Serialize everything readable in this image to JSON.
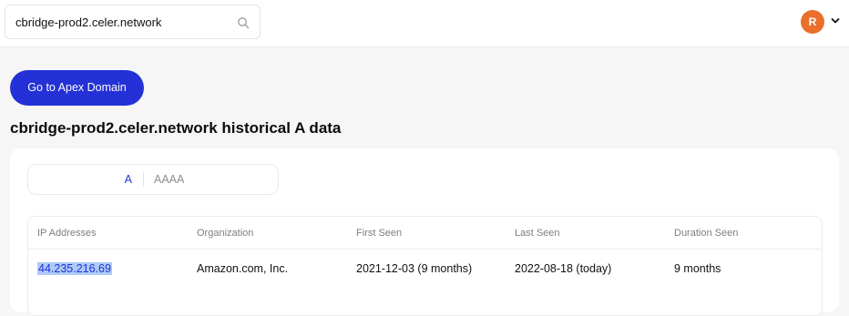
{
  "search": {
    "value": "cbridge-prod2.celer.network",
    "icon": "search-icon"
  },
  "user": {
    "avatar_initial": "R",
    "avatar_color": "#e8702a",
    "menu_icon": "chevron-down-icon"
  },
  "apex_button": {
    "label": "Go to Apex Domain",
    "color": "#2431d6"
  },
  "page": {
    "title": "cbridge-prod2.celer.network historical A data"
  },
  "record_toggle": {
    "options": [
      "A",
      "AAAA"
    ],
    "selected": "A"
  },
  "table": {
    "columns": [
      "IP Addresses",
      "Organization",
      "First Seen",
      "Last Seen",
      "Duration Seen"
    ],
    "rows": [
      [
        "44.235.216.69",
        "Amazon.com, Inc.",
        "2021-12-03 (9 months)",
        "2022-08-18 (today)",
        "9 months"
      ]
    ]
  }
}
